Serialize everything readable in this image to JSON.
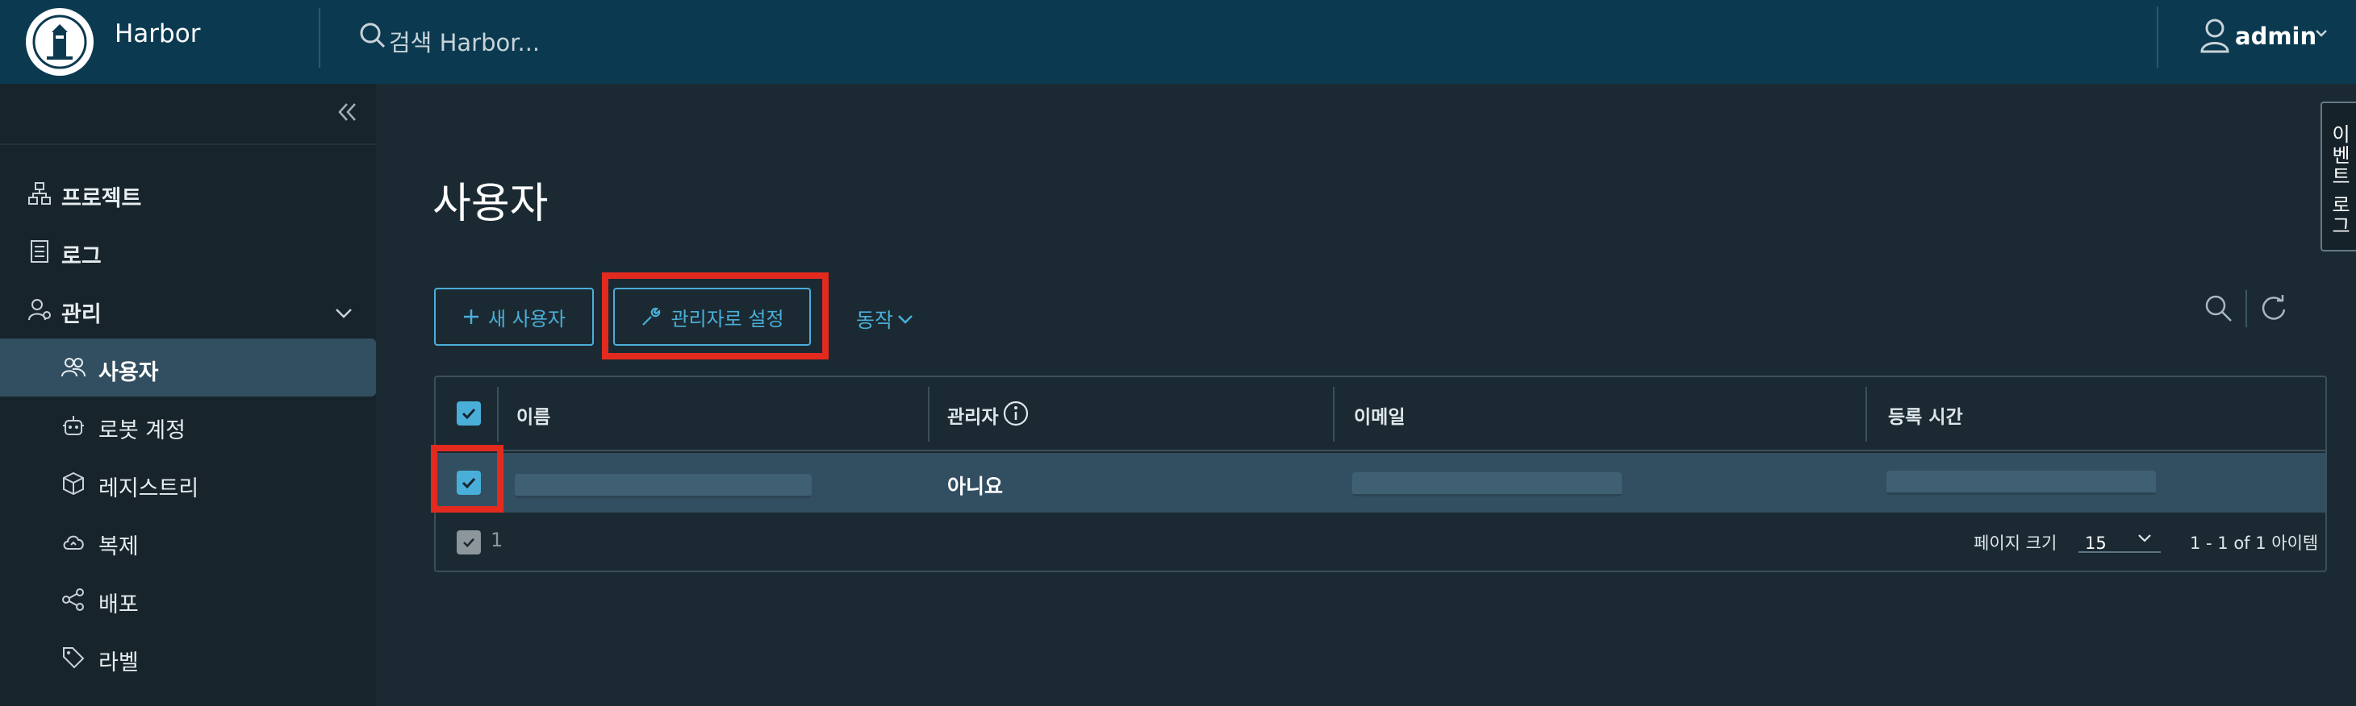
{
  "header": {
    "brand": "Harbor",
    "search_placeholder": "검색 Harbor...",
    "user": "admin"
  },
  "sidebar": {
    "items": [
      {
        "label": "프로젝트",
        "icon": "projects-icon"
      },
      {
        "label": "로그",
        "icon": "logs-icon"
      },
      {
        "label": "관리",
        "icon": "admin-icon"
      },
      {
        "label": "사용자",
        "icon": "users-icon"
      },
      {
        "label": "로봇 계정",
        "icon": "robot-icon"
      },
      {
        "label": "레지스트리",
        "icon": "registry-icon"
      },
      {
        "label": "복제",
        "icon": "cloud-icon"
      },
      {
        "label": "배포",
        "icon": "share-icon"
      },
      {
        "label": "라벨",
        "icon": "tag-icon"
      }
    ]
  },
  "page": {
    "title": "사용자",
    "new_user_label": "새 사용자",
    "set_admin_label": "관리자로 설정",
    "actions_label": "동작"
  },
  "table": {
    "columns": [
      "이름",
      "관리자",
      "이메일",
      "등록 시간"
    ],
    "rows": [
      {
        "name": "",
        "admin": "아니요",
        "email": "",
        "registered": ""
      }
    ],
    "selected_count": "1",
    "page_size_label": "페이지 크기",
    "page_size": "15",
    "page_info": "1 - 1 of 1 아이템"
  },
  "event_log_tab": "이벤트 로그",
  "colors": {
    "header_bg": "#0b3a50",
    "accent": "#49afd9",
    "highlight": "#e32a1f",
    "selected_row": "#324f61"
  }
}
